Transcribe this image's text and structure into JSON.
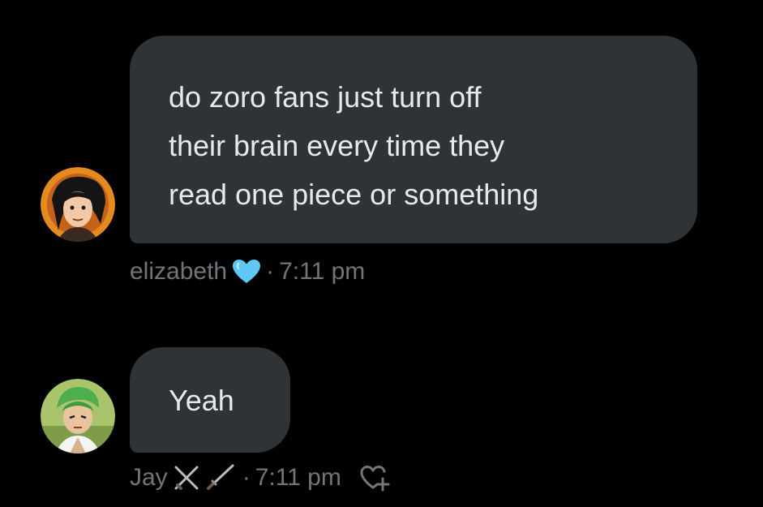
{
  "messages": [
    {
      "lines": [
        "do zoro fans just turn off",
        "their brain every time they",
        "read one piece or something"
      ],
      "sender": "elizabeth",
      "emoji": "blue-heart-icon",
      "separator": "·",
      "time": "7:11 pm"
    },
    {
      "text": "Yeah",
      "sender": "Jay",
      "emoji": "crossed-swords-icon",
      "separator": "·",
      "time": "7:11 pm",
      "reaction": "add-reaction-heart-icon"
    }
  ],
  "colors": {
    "background": "#000000",
    "bubble": "#2f3336",
    "text": "#e7e9ea",
    "meta": "#71767b",
    "heart": "#5ec8f2"
  }
}
